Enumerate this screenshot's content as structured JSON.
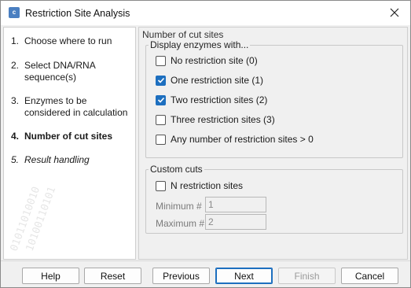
{
  "window": {
    "title": "Restriction Site Analysis",
    "icon": "app-icon"
  },
  "steps": [
    {
      "num": "1.",
      "label": "Choose where to run"
    },
    {
      "num": "2.",
      "label": "Select DNA/RNA sequence(s)"
    },
    {
      "num": "3.",
      "label": "Enzymes to be considered in calculation"
    },
    {
      "num": "4.",
      "label": "Number of cut sites"
    },
    {
      "num": "5.",
      "label": "Result handling"
    }
  ],
  "main": {
    "section_title": "Number of cut sites",
    "display_group": {
      "legend": "Display enzymes with...",
      "options": [
        {
          "label": "No restriction site (0)",
          "checked": false
        },
        {
          "label": "One restriction site (1)",
          "checked": true
        },
        {
          "label": "Two restriction sites (2)",
          "checked": true
        },
        {
          "label": "Three restriction sites (3)",
          "checked": false
        },
        {
          "label": "Any number of restriction sites > 0",
          "checked": false
        }
      ]
    },
    "custom_group": {
      "legend": "Custom cuts",
      "n_sites_label": "N restriction sites",
      "n_sites_checked": false,
      "minimum_label": "Minimum #",
      "minimum_value": "1",
      "maximum_label": "Maximum #",
      "maximum_value": "2"
    }
  },
  "footer": {
    "help": "Help",
    "reset": "Reset",
    "previous": "Previous",
    "next": "Next",
    "finish": "Finish",
    "cancel": "Cancel"
  },
  "colors": {
    "accent": "#1d6fbf",
    "window_bg": "#f0f0f0"
  }
}
